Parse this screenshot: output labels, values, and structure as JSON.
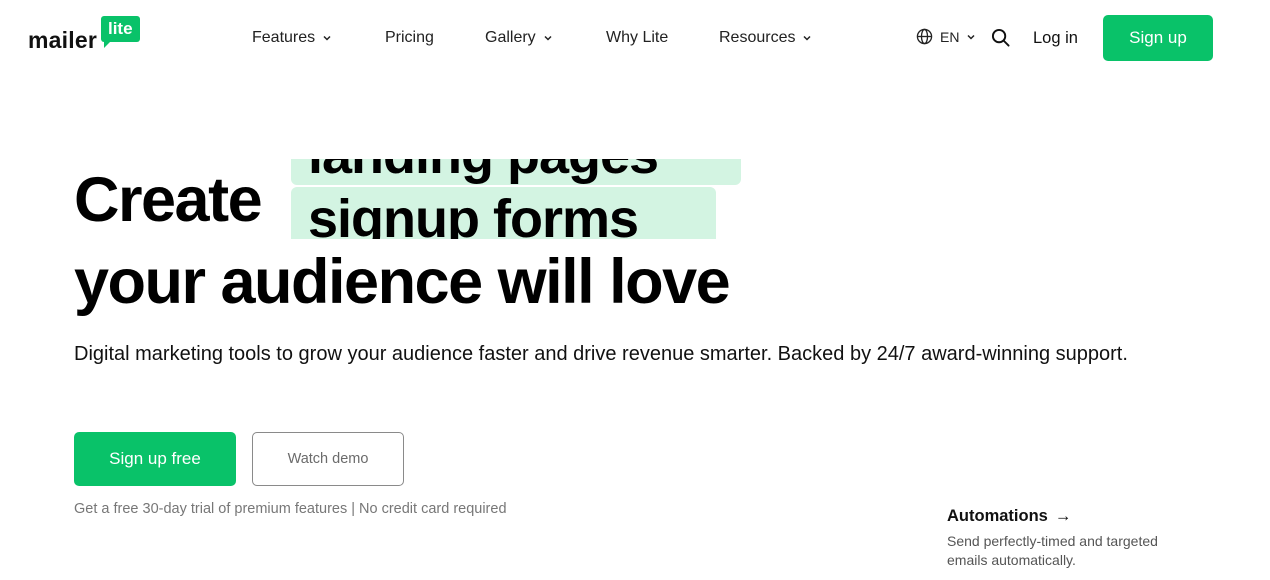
{
  "brand": {
    "word": "mailer",
    "badge": "lite",
    "accent": "#09c269",
    "highlight": "#d3f4e2"
  },
  "nav": {
    "items": [
      {
        "label": "Features",
        "dropdown": true
      },
      {
        "label": "Pricing",
        "dropdown": false
      },
      {
        "label": "Gallery",
        "dropdown": true
      },
      {
        "label": "Why Lite",
        "dropdown": false
      },
      {
        "label": "Resources",
        "dropdown": true
      }
    ],
    "language": "EN",
    "login": "Log in",
    "signup": "Sign up"
  },
  "hero": {
    "word": "Create",
    "rotating": [
      "landing pages",
      "signup forms"
    ],
    "line2": "your audience will love",
    "subtitle": "Digital marketing tools to grow your audience faster and drive revenue smarter. Backed by 24/7 award-winning support.",
    "cta_primary": "Sign up free",
    "cta_secondary": "Watch demo",
    "note": "Get a free 30-day trial of premium features | No credit card required"
  },
  "feature": {
    "title": "Automations",
    "arrow": "→",
    "description": "Send perfectly-timed and targeted emails automatically."
  }
}
